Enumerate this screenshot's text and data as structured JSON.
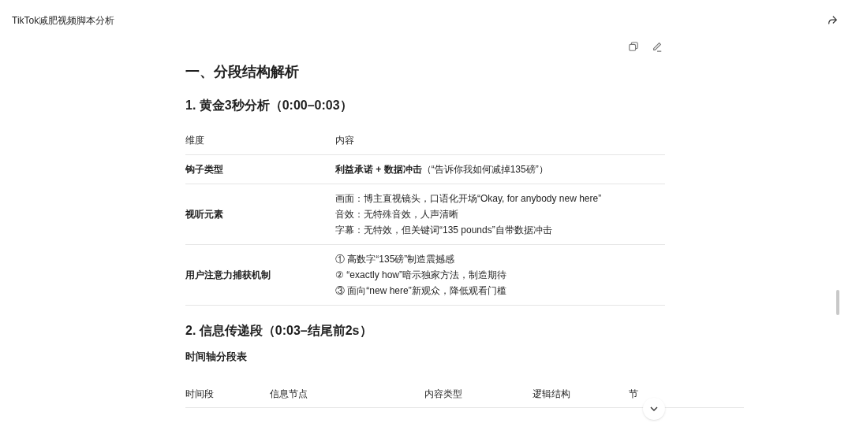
{
  "header": {
    "title": "TikTok减肥视频脚本分析"
  },
  "heading_1": "一、分段结构解析",
  "section_1": {
    "heading": "1. 黄金3秒分析（0:00–0:03）",
    "table": {
      "columns": [
        "维度",
        "内容"
      ],
      "rows": [
        {
          "label": "钩子类型",
          "lines": [
            "**利益承诺 + 数据冲击**（“告诉你我如何减掉135磅”）"
          ]
        },
        {
          "label": "视听元素",
          "lines": [
            "画面：博主直视镜头，口语化开场“Okay, for anybody new here”",
            "音效：无特殊音效，人声清晰",
            "字幕：无特效，但关键词“135 pounds”自带数据冲击"
          ]
        },
        {
          "label": "用户注意力捕获机制",
          "lines": [
            "① 高数字“135磅”制造震撼感",
            "② “exactly how”暗示独家方法，制造期待",
            "③ 面向“new here”新观众，降低观看门槛"
          ]
        }
      ]
    }
  },
  "section_2": {
    "heading": "2. 信息传递段（0:03–结尾前2s）",
    "subheading": "时间轴分段表",
    "table": {
      "columns": [
        "时间段",
        "信息节点",
        "内容类型",
        "逻辑结构",
        "节"
      ]
    }
  }
}
